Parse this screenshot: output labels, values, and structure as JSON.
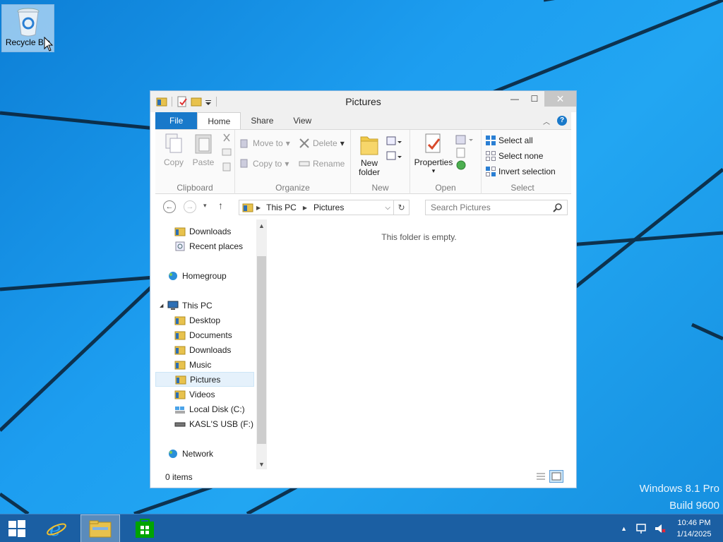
{
  "desktop": {
    "icons": [
      {
        "label": "Recycle Bin",
        "icon": "recycle-bin-icon"
      }
    ],
    "watermark": {
      "line1": "Windows 8.1 Pro",
      "line2": "Build 9600"
    }
  },
  "window": {
    "title": "Pictures",
    "ribbon_tabs": [
      "File",
      "Home",
      "Share",
      "View"
    ],
    "active_tab": "Home",
    "clipboard": {
      "copy": "Copy",
      "paste": "Paste",
      "label": "Clipboard"
    },
    "organize": {
      "move_to": "Move to",
      "copy_to": "Copy to",
      "delete": "Delete",
      "rename": "Rename",
      "label": "Organize"
    },
    "new": {
      "new_folder_line1": "New",
      "new_folder_line2": "folder",
      "label": "New"
    },
    "open": {
      "properties": "Properties",
      "label": "Open"
    },
    "select": {
      "select_all": "Select all",
      "select_none": "Select none",
      "invert": "Invert selection",
      "label": "Select"
    },
    "address": {
      "crumbs": [
        "This PC",
        "Pictures"
      ]
    },
    "search": {
      "placeholder": "Search Pictures"
    },
    "nav_items": [
      {
        "label": "Downloads",
        "icon": "downloads-folder-icon",
        "indent": 1
      },
      {
        "label": "Recent places",
        "icon": "recent-places-icon",
        "indent": 1
      },
      {
        "label": "Homegroup",
        "icon": "homegroup-icon",
        "indent": 0
      },
      {
        "label": "This PC",
        "icon": "this-pc-icon",
        "indent": 0
      },
      {
        "label": "Desktop",
        "icon": "desktop-folder-icon",
        "indent": 1
      },
      {
        "label": "Documents",
        "icon": "documents-folder-icon",
        "indent": 1
      },
      {
        "label": "Downloads",
        "icon": "downloads-folder-icon",
        "indent": 1
      },
      {
        "label": "Music",
        "icon": "music-folder-icon",
        "indent": 1
      },
      {
        "label": "Pictures",
        "icon": "pictures-folder-icon",
        "indent": 1,
        "selected": true
      },
      {
        "label": "Videos",
        "icon": "videos-folder-icon",
        "indent": 1
      },
      {
        "label": "Local Disk (C:)",
        "icon": "local-disk-icon",
        "indent": 1
      },
      {
        "label": "KASL'S USB (F:)",
        "icon": "usb-drive-icon",
        "indent": 1
      },
      {
        "label": "Network",
        "icon": "network-icon",
        "indent": 0
      }
    ],
    "empty_message": "This folder is empty.",
    "status": {
      "item_count": "0 items"
    }
  },
  "taskbar": {
    "pinned": [
      "start-button",
      "internet-explorer",
      "file-explorer",
      "store"
    ],
    "active": "file-explorer",
    "clock": {
      "time": "10:46 PM",
      "date": "1/14/2025"
    }
  },
  "colors": {
    "accent": "#1979ca",
    "desktop": "#1a9ee6",
    "taskbar": "#1b5fa3"
  }
}
